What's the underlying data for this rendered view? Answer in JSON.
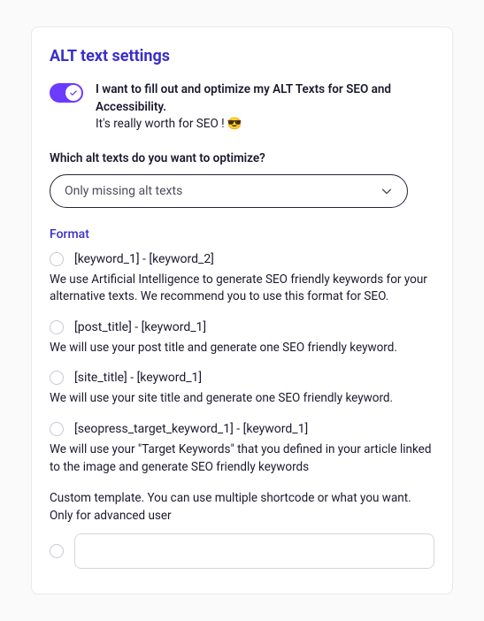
{
  "title": "ALT text settings",
  "toggle": {
    "line1": "I want to fill out and optimize my ALT Texts for SEO and Accessibility.",
    "line2": "It's really worth for SEO ! 😎"
  },
  "optimize": {
    "label": "Which alt texts do you want to optimize?",
    "selected": "Only missing alt texts"
  },
  "format": {
    "label": "Format",
    "options": [
      {
        "label": "[keyword_1] - [keyword_2]",
        "desc": "We use Artificial Intelligence to generate SEO friendly keywords for your alternative texts. We recommend you to use this format for SEO."
      },
      {
        "label": "[post_title] - [keyword_1]",
        "desc": "We will use your post title and generate one SEO friendly keyword."
      },
      {
        "label": "[site_title] - [keyword_1]",
        "desc": "We will use your site title and generate one SEO friendly keyword."
      },
      {
        "label": "[seopress_target_keyword_1] - [keyword_1]",
        "desc": "We will use your \"Target Keywords\" that you defined in your article linked to the image and generate SEO friendly keywords"
      }
    ],
    "custom_desc": "Custom template. You can use multiple shortcode or what you want. Only for advanced user",
    "custom_value": ""
  }
}
